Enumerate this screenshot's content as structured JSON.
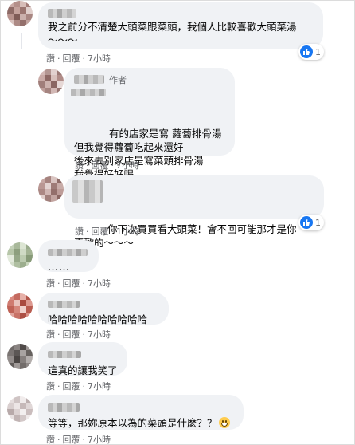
{
  "comments": [
    {
      "id": "c1",
      "text": "我之前分不清楚大頭菜跟菜頭，我個人比較喜歡大頭菜湯\n～～～",
      "actions": {
        "like": "讚",
        "reply": "回覆",
        "time": "7小時"
      },
      "reaction_count": "1"
    },
    {
      "id": "c2",
      "role": "作者",
      "text": "有的店家是寫 蘿蔔排骨湯\n但我覺得蘿蔔吃起來還好\n後來去別家店是寫菜頭排骨湯\n我覺得好好喝\n才想說要自己煮菜頭排骨",
      "actions": {
        "like": "讚",
        "reply": "回覆",
        "time": "7小時"
      }
    },
    {
      "id": "c3",
      "text": "你下次買買看大頭菜！會不回可能那才是你\n喜歡的～～～",
      "actions": {
        "like": "讚",
        "reply": "回覆",
        "time": "1小時"
      },
      "reaction_count": "1"
    },
    {
      "id": "c4",
      "text": "……",
      "actions": {
        "like": "讚",
        "reply": "回覆",
        "time": "7小時"
      }
    },
    {
      "id": "c5",
      "text": "哈哈哈哈哈哈哈哈哈哈",
      "actions": {
        "like": "讚",
        "reply": "回覆",
        "time": "7小時"
      }
    },
    {
      "id": "c6",
      "text": "這真的讓我笑了",
      "actions": {
        "like": "讚",
        "reply": "回覆",
        "time": "7小時"
      }
    },
    {
      "id": "c7",
      "text": "等等，那妳原本以為的菜頭是什麼？？",
      "actions": {
        "like": "讚",
        "reply": "回覆",
        "time": "7小時"
      }
    }
  ],
  "icons": {
    "like": "thumbs-up-icon",
    "laugh": "laughing-emoji-icon"
  },
  "colors": {
    "like_blue": "#1877f2",
    "bubble": "#f0f2f5",
    "meta_text": "#65676b"
  }
}
